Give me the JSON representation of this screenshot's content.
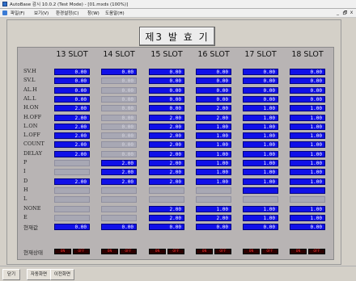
{
  "window": {
    "title": "AutoBase 감시 10.0.2 (Test Mode) - [01.mxds (100%)]"
  },
  "menu": {
    "items": [
      {
        "label": "파일(F)"
      },
      {
        "label": "보기(V)"
      },
      {
        "label": "환경설정(C)"
      },
      {
        "label": "창(W)"
      },
      {
        "label": "도움말(H)"
      }
    ],
    "controls": {
      "minimize": "_",
      "restore": "🗗",
      "close": "x"
    }
  },
  "heading": "제3 발 효 기",
  "columns": [
    {
      "label": "13 SLOT"
    },
    {
      "label": "14 SLOT"
    },
    {
      "label": "15 SLOT"
    },
    {
      "label": "16 SLOT"
    },
    {
      "label": "17 SLOT"
    },
    {
      "label": "18 SLOT"
    }
  ],
  "rows": [
    {
      "label": "SV.H",
      "values": [
        "0.00",
        "0.00",
        "0.00",
        "0.00",
        "0.00",
        "0.00"
      ],
      "styles": [
        "b",
        "b",
        "b",
        "b",
        "b",
        "b"
      ]
    },
    {
      "label": "SV.L",
      "values": [
        "0.00",
        "0.00",
        "0.00",
        "0.00",
        "0.00",
        "0.00"
      ],
      "styles": [
        "b",
        "g",
        "b",
        "b",
        "b",
        "b"
      ]
    },
    {
      "label": "AL.H",
      "values": [
        "0.00",
        "0.00",
        "0.00",
        "0.00",
        "0.00",
        "0.00"
      ],
      "styles": [
        "b",
        "g",
        "b",
        "b",
        "b",
        "b"
      ]
    },
    {
      "label": "AL.L",
      "values": [
        "0.00",
        "0.00",
        "0.00",
        "0.00",
        "0.00",
        "0.00"
      ],
      "styles": [
        "b",
        "g",
        "b",
        "b",
        "b",
        "b"
      ]
    },
    {
      "label": "H.ON",
      "values": [
        "2.00",
        "0.00",
        "0.00",
        "2.00",
        "1.00",
        "1.00"
      ],
      "styles": [
        "b",
        "g",
        "b",
        "b",
        "b",
        "b"
      ]
    },
    {
      "label": "H.OFF",
      "values": [
        "2.00",
        "0.00",
        "2.00",
        "2.00",
        "1.00",
        "1.00"
      ],
      "styles": [
        "b",
        "g",
        "b",
        "b",
        "b",
        "b"
      ]
    },
    {
      "label": "L.ON",
      "values": [
        "2.00",
        "0.00",
        "2.00",
        "1.00",
        "1.00",
        "1.00"
      ],
      "styles": [
        "b",
        "g",
        "b",
        "b",
        "b",
        "b"
      ]
    },
    {
      "label": "L.OFF",
      "values": [
        "2.00",
        "0.00",
        "2.00",
        "1.00",
        "1.00",
        "1.00"
      ],
      "styles": [
        "b",
        "g",
        "b",
        "b",
        "b",
        "b"
      ]
    },
    {
      "label": "COUNT",
      "values": [
        "2.00",
        "0.00",
        "2.00",
        "1.00",
        "1.00",
        "1.00"
      ],
      "styles": [
        "b",
        "g",
        "b",
        "b",
        "b",
        "b"
      ]
    },
    {
      "label": "DELAY",
      "values": [
        "2.00",
        "0.00",
        "2.00",
        "1.00",
        "1.00",
        "1.00"
      ],
      "styles": [
        "b",
        "g",
        "b",
        "b",
        "b",
        "b"
      ]
    },
    {
      "label": "P",
      "values": [
        "",
        "2.00",
        "2.00",
        "1.00",
        "1.00",
        "1.00"
      ],
      "styles": [
        "g",
        "b",
        "b",
        "b",
        "b",
        "b"
      ]
    },
    {
      "label": "I",
      "values": [
        "",
        "2.00",
        "2.00",
        "1.00",
        "1.00",
        "1.00"
      ],
      "styles": [
        "g",
        "b",
        "b",
        "b",
        "b",
        "b"
      ]
    },
    {
      "label": "D",
      "values": [
        "2.00",
        "2.00",
        "2.00",
        "1.00",
        "1.00",
        "1.00"
      ],
      "styles": [
        "b",
        "b",
        "b",
        "b",
        "b",
        "b"
      ]
    },
    {
      "label": "H",
      "values": [
        "",
        "",
        "",
        "",
        "",
        ""
      ],
      "styles": [
        "g",
        "g",
        "g",
        "g",
        "f",
        "f"
      ]
    },
    {
      "label": "L",
      "values": [
        "",
        "",
        "",
        "",
        "",
        ""
      ],
      "styles": [
        "g",
        "g",
        "g",
        "g",
        "g",
        "g"
      ]
    },
    {
      "label": "NONE",
      "values": [
        "",
        "",
        "2.00",
        "1.00",
        "1.00",
        "1.00"
      ],
      "styles": [
        "g",
        "g",
        "b",
        "b",
        "b",
        "b"
      ]
    },
    {
      "label": "E",
      "values": [
        "",
        "",
        "2.00",
        "2.00",
        "1.00",
        "1.00"
      ],
      "styles": [
        "g",
        "g",
        "b",
        "b",
        "b",
        "b"
      ]
    },
    {
      "label": "현재값",
      "values": [
        "0.00",
        "0.00",
        "0.00",
        "0.00",
        "0.00",
        "0.00"
      ],
      "styles": [
        "b",
        "b",
        "b",
        "b",
        "b",
        "b"
      ]
    }
  ],
  "status_row": {
    "label": "현재상태",
    "cells": [
      [
        "ON",
        "OFF"
      ],
      [
        "ON",
        "OFF"
      ],
      [
        "ON",
        "OFF"
      ],
      [
        "ON",
        "OFF"
      ],
      [
        "ON",
        "OFF"
      ],
      [
        "ON",
        "OFF"
      ]
    ]
  },
  "bottom_tabs": [
    {
      "label": "닫기"
    },
    {
      "label": "자동화면"
    },
    {
      "label": "이전화면"
    }
  ],
  "colors": {
    "cell_active": "#1010e8",
    "cell_inactive": "#a8a8b4",
    "board": "#b8b4b4",
    "status_text": "#ff3030"
  }
}
